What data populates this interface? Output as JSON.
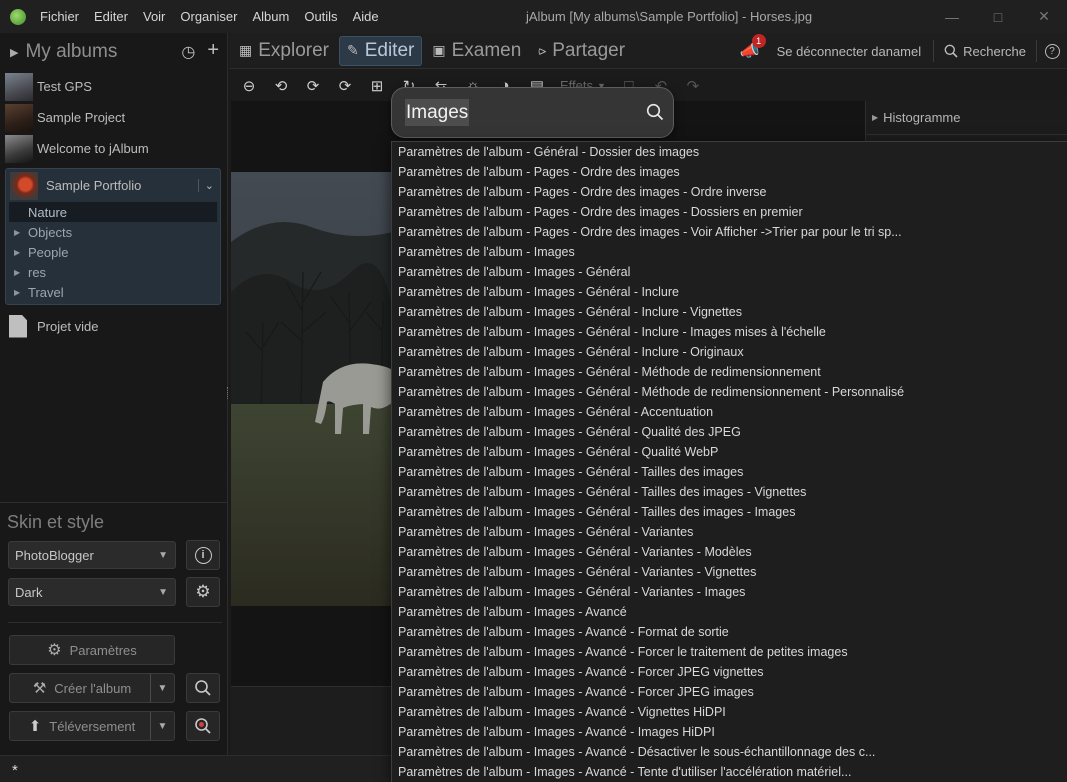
{
  "app": {
    "window_title": "jAlbum [My albums\\Sample Portfolio] - Horses.jpg",
    "menu": [
      "Fichier",
      "Editer",
      "Voir",
      "Organiser",
      "Album",
      "Outils",
      "Aide"
    ]
  },
  "sidebar": {
    "title": "My albums",
    "albums": [
      {
        "label": "Test GPS",
        "thumb": "gps"
      },
      {
        "label": "Sample Project",
        "thumb": "sp"
      },
      {
        "label": "Welcome to jAlbum",
        "thumb": "wj"
      }
    ],
    "current_project": {
      "label": "Sample Portfolio",
      "folders": [
        {
          "label": "Nature",
          "selected": true
        },
        {
          "label": "Objects",
          "selected": false
        },
        {
          "label": "People",
          "selected": false
        },
        {
          "label": "res",
          "selected": false
        },
        {
          "label": "Travel",
          "selected": false
        }
      ]
    },
    "empty_project": "Projet vide"
  },
  "skin_panel": {
    "title": "Skin et style",
    "skin": "PhotoBlogger",
    "style": "Dark",
    "settings_label": "Paramètres",
    "make_album_label": "Créer l'album",
    "upload_label": "Téléversement"
  },
  "tabs": [
    {
      "label": "Explorer",
      "icon": "grid-icon",
      "active": false
    },
    {
      "label": "Editer",
      "icon": "pencil-icon",
      "active": true
    },
    {
      "label": "Examen",
      "icon": "preview-icon",
      "active": false
    },
    {
      "label": "Partager",
      "icon": "share-icon",
      "active": false
    }
  ],
  "top_right": {
    "notification_count": "1",
    "logout_label": "Se déconnecter danamel",
    "search_label": "Recherche",
    "help": "?"
  },
  "edit_toolbar": {
    "effects_label": "Effets"
  },
  "right_panel": {
    "histogram_label": "Histogramme"
  },
  "search": {
    "query": "Images",
    "results": [
      "Paramètres de l'album - Général - Dossier des images",
      "Paramètres de l'album - Pages - Ordre des images",
      "Paramètres de l'album - Pages - Ordre des images - Ordre inverse",
      "Paramètres de l'album - Pages - Ordre des images - Dossiers en premier",
      "Paramètres de l'album - Pages - Ordre des images - Voir Afficher ->Trier par pour le tri sp...",
      "Paramètres de l'album - Images",
      "Paramètres de l'album - Images - Général",
      "Paramètres de l'album - Images - Général - Inclure",
      "Paramètres de l'album - Images - Général - Inclure - Vignettes",
      "Paramètres de l'album - Images - Général - Inclure - Images mises à l'échelle",
      "Paramètres de l'album - Images - Général - Inclure - Originaux",
      "Paramètres de l'album - Images - Général - Méthode de redimensionnement",
      "Paramètres de l'album - Images - Général - Méthode de redimensionnement - Personnalisé",
      "Paramètres de l'album - Images - Général - Accentuation",
      "Paramètres de l'album - Images - Général - Qualité des JPEG",
      "Paramètres de l'album - Images - Général - Qualité WebP",
      "Paramètres de l'album - Images - Général - Tailles des images",
      "Paramètres de l'album - Images - Général - Tailles des images - Vignettes",
      "Paramètres de l'album - Images - Général - Tailles des images - Images",
      "Paramètres de l'album - Images - Général - Variantes",
      "Paramètres de l'album - Images - Général - Variantes - Modèles",
      "Paramètres de l'album - Images - Général - Variantes - Vignettes",
      "Paramètres de l'album - Images - Général - Variantes - Images",
      "Paramètres de l'album - Images - Avancé",
      "Paramètres de l'album - Images - Avancé - Format de sortie",
      "Paramètres de l'album - Images - Avancé - Forcer le traitement de petites images",
      "Paramètres de l'album - Images - Avancé - Forcer JPEG vignettes",
      "Paramètres de l'album - Images - Avancé - Forcer JPEG images",
      "Paramètres de l'album - Images - Avancé - Vignettes HiDPI",
      "Paramètres de l'album - Images - Avancé - Images HiDPI",
      "Paramètres de l'album - Images - Avancé - Désactiver le sous-échantillonnage des c...",
      "Paramètres de l'album - Images - Avancé - Tente d'utiliser l'accélération matériel..."
    ]
  },
  "statusbar": {
    "indicator": "*"
  },
  "colors": {
    "accent_tab": "#2c3a48",
    "badge": "#c02525"
  }
}
